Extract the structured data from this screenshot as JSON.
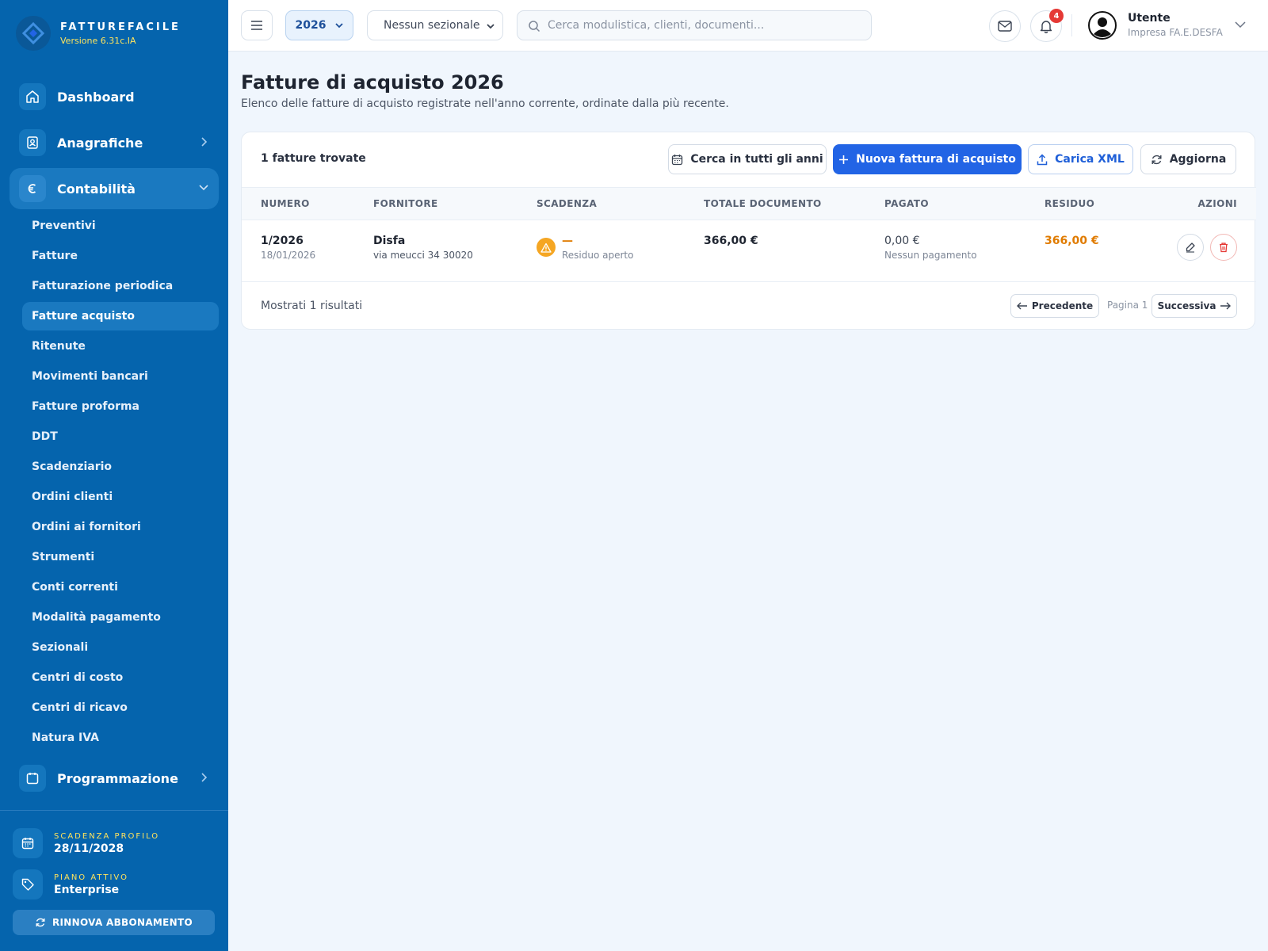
{
  "brand": {
    "name": "FATTUREFACILE",
    "version": "Versione 6.31c.IA"
  },
  "sidebar": {
    "dashboard": "Dashboard",
    "anagrafiche": "Anagrafiche",
    "contabilita": "Contabilità",
    "programmazione": "Programmazione",
    "sub_items": [
      "Preventivi",
      "Fatture",
      "Fatturazione periodica",
      "Fatture acquisto",
      "Ritenute",
      "Movimenti bancari",
      "Fatture proforma",
      "DDT",
      "Scadenziario",
      "Ordini clienti",
      "Ordini ai fornitori",
      "Strumenti",
      "Conti correnti",
      "Modalità pagamento",
      "Sezionali",
      "Centri di costo",
      "Centri di ricavo",
      "Natura IVA"
    ],
    "active_sub": "Fatture acquisto",
    "scadenza_label": "SCADENZA PROFILO",
    "scadenza_value": "28/11/2028",
    "piano_label": "PIANO ATTIVO",
    "piano_value": "Enterprise",
    "renew": "RINNOVA ABBONAMENTO"
  },
  "topbar": {
    "year": "2026",
    "sezionale": "Nessun sezionale",
    "search_placeholder": "Cerca modulistica, clienti, documenti...",
    "notifications": "4",
    "user_name": "Utente",
    "user_company": "Impresa FA.E.DESFA"
  },
  "page": {
    "title": "Fatture di acquisto 2026",
    "subtitle": "Elenco delle fatture di acquisto registrate nell'anno corrente, ordinate dalla più recente."
  },
  "card": {
    "count": "1 fatture trovate",
    "btn_all_years": "Cerca in tutti gli anni",
    "btn_new": "Nuova fattura di acquisto",
    "btn_xml": "Carica XML",
    "btn_refresh": "Aggiorna",
    "columns": {
      "numero": "NUMERO",
      "fornitore": "FORNITORE",
      "scadenza": "SCADENZA",
      "totale": "TOTALE DOCUMENTO",
      "pagato": "PAGATO",
      "residuo": "RESIDUO",
      "azioni": "AZIONI"
    },
    "rows": [
      {
        "numero": "1/2026",
        "data": "18/01/2026",
        "fornitore": "Disfa",
        "indirizzo": "via meucci 34 30020",
        "scadenza": "—",
        "scadenza_note": "Residuo aperto",
        "totale": "366,00 €",
        "pagato": "0,00 €",
        "pagato_note": "Nessun pagamento",
        "residuo": "366,00 €"
      }
    ],
    "footer": "Mostrati 1 risultati",
    "prev": "Precedente",
    "page_label": "Pagina 1",
    "next": "Successiva"
  },
  "colors": {
    "sidebar": "#0564ad",
    "primary": "#2264e5",
    "warning": "#f5a623",
    "residuo": "#e07b00",
    "danger": "#e53935"
  }
}
